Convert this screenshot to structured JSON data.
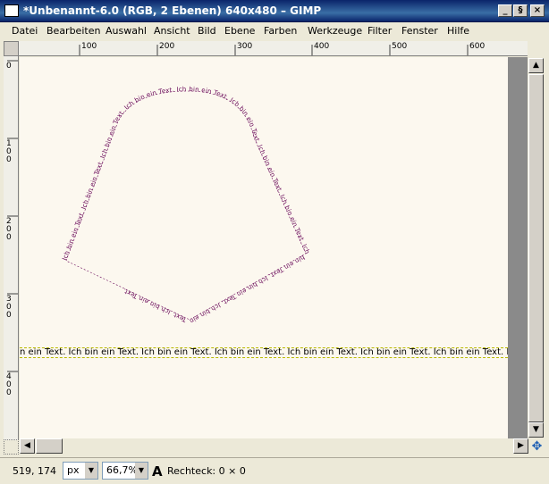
{
  "window": {
    "title": "*Unbenannt-6.0 (RGB, 2 Ebenen) 640x480 – GIMP",
    "minimize_glyph": "_",
    "restore_glyph": "§",
    "close_glyph": "×"
  },
  "menu": {
    "items": [
      "Datei",
      "Bearbeiten",
      "Auswahl",
      "Ansicht",
      "Bild",
      "Ebene",
      "Farben",
      "Werkzeuge",
      "Filter",
      "Fenster",
      "Hilfe"
    ]
  },
  "ruler": {
    "horizontal": [
      "100",
      "200",
      "300",
      "400",
      "500",
      "600"
    ],
    "vertical": [
      "0",
      "100",
      "200",
      "300",
      "400"
    ]
  },
  "canvas": {
    "text_layer": "n ein Text. Ich bin ein Text. Ich bin ein Text. Ich bin ein Text. Ich bin ein Text. Ich bin ein Text. Ich bin ein Text. Ich bin e",
    "path_text": "Ich bin ein Text. Ich bin ein Text. Ich bin ein Text. Ich bin ein Text. Ich bin ein Text. Ich bin ein Text. Ich bin ein Text. Ich bin ein Text. Ich bin ein Text. Ich bin ein Text. Ich bin ein Text. Ich bin ein Text.",
    "path_color": "#6a0a5a"
  },
  "status": {
    "coordinates": "519, 174",
    "unit": "px",
    "zoom": "66,7%",
    "tool_letter": "A",
    "message": "Rechteck: 0 × 0"
  }
}
